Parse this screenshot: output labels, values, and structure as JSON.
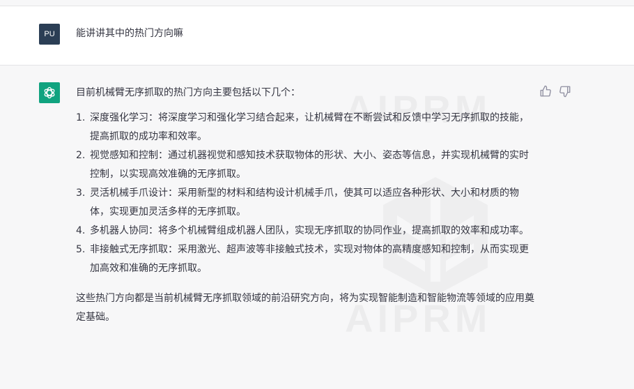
{
  "user": {
    "avatar_initials": "PU",
    "message": "能讲讲其中的热门方向嘛"
  },
  "assistant": {
    "intro": "目前机械臂无序抓取的热门方向主要包括以下几个：",
    "points": [
      {
        "num": "1.",
        "text": "深度强化学习：将深度学习和强化学习结合起来，让机械臂在不断尝试和反馈中学习无序抓取的技能，提高抓取的成功率和效率。"
      },
      {
        "num": "2.",
        "text": "视觉感知和控制：通过机器视觉和感知技术获取物体的形状、大小、姿态等信息，并实现机械臂的实时控制，以实现高效准确的无序抓取。"
      },
      {
        "num": "3.",
        "text": "灵活机械手爪设计：采用新型的材料和结构设计机械手爪，使其可以适应各种形状、大小和材质的物体，实现更加灵活多样的无序抓取。"
      },
      {
        "num": "4.",
        "text": "多机器人协同：将多个机械臂组成机器人团队，实现无序抓取的协同作业，提高抓取的效率和成功率。"
      },
      {
        "num": "5.",
        "text": "非接触式无序抓取：采用激光、超声波等非接触式技术，实现对物体的高精度感知和控制，从而实现更加高效和准确的无序抓取。"
      }
    ],
    "outro": "这些热门方向都是当前机械臂无序抓取领域的前沿研究方向，将为实现智能制造和智能物流等领域的应用奠定基础。"
  },
  "watermark": {
    "text_top": "AIPRM",
    "text_bottom": "AIPRM"
  },
  "icons": {
    "assistant_avatar": "openai-logo-icon",
    "thumbs_up": "thumbs-up-icon",
    "thumbs_down": "thumbs-down-icon"
  },
  "colors": {
    "assistant_avatar_bg": "#10a37f",
    "user_avatar_bg": "#2b3e55",
    "assistant_bg": "#f7f7f8",
    "text": "#343541"
  }
}
